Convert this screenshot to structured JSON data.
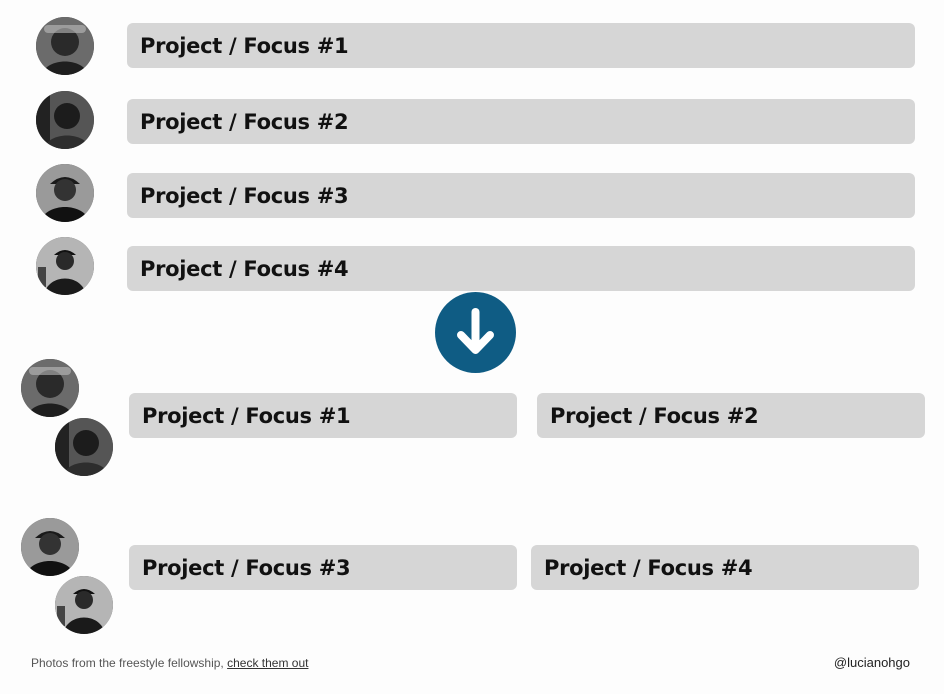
{
  "top_list": [
    {
      "label": "Project / Focus #1",
      "avatar": "person-1"
    },
    {
      "label": "Project / Focus #2",
      "avatar": "person-2"
    },
    {
      "label": "Project / Focus #3",
      "avatar": "person-3"
    },
    {
      "label": "Project / Focus #4",
      "avatar": "person-4"
    }
  ],
  "arrow": {
    "icon": "arrow-down-icon",
    "color": "#0f5c84"
  },
  "bottom_grid": [
    {
      "label": "Project / Focus #1"
    },
    {
      "label": "Project / Focus #2"
    },
    {
      "label": "Project / Focus #3"
    },
    {
      "label": "Project / Focus #4"
    }
  ],
  "footer": {
    "credit_text": "Photos from the freestyle fellowship, ",
    "credit_link": "check them out",
    "handle": "@lucianohgo"
  },
  "colors": {
    "bar": "#d6d6d6",
    "text": "#111111",
    "accent": "#0f5c84",
    "background": "#fdfdfd"
  }
}
